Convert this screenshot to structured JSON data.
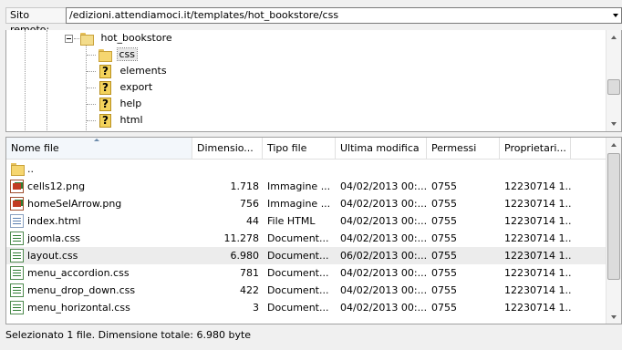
{
  "remote_bar": {
    "label": "Sito remoto:",
    "path": "/edizioni.attendiamoci.it/templates/hot_bookstore/css"
  },
  "tree": {
    "parent": {
      "label": "hot_bookstore",
      "icon": "open-folder-icon"
    },
    "children": [
      {
        "label": "css",
        "icon": "folder-icon",
        "selected": true
      },
      {
        "label": "elements",
        "icon": "unknown-folder-icon"
      },
      {
        "label": "export",
        "icon": "unknown-folder-icon"
      },
      {
        "label": "help",
        "icon": "unknown-folder-icon"
      },
      {
        "label": "html",
        "icon": "unknown-folder-icon"
      }
    ]
  },
  "file_list": {
    "columns": [
      "Nome file",
      "Dimensio...",
      "Tipo file",
      "Ultima modifica",
      "Permessi",
      "Proprietari..."
    ],
    "rows": [
      {
        "icon": "folder",
        "name": "..",
        "size": "",
        "type": "",
        "modified": "",
        "perms": "",
        "owner": ""
      },
      {
        "icon": "img",
        "name": "cells12.png",
        "size": "1.718",
        "type": "Immagine ...",
        "modified": "04/02/2013 00:...",
        "perms": "0755",
        "owner": "12230714 1..."
      },
      {
        "icon": "img",
        "name": "homeSelArrow.png",
        "size": "756",
        "type": "Immagine ...",
        "modified": "04/02/2013 00:...",
        "perms": "0755",
        "owner": "12230714 1..."
      },
      {
        "icon": "html",
        "name": "index.html",
        "size": "44",
        "type": "File HTML",
        "modified": "04/02/2013 00:...",
        "perms": "0755",
        "owner": "12230714 1..."
      },
      {
        "icon": "css",
        "name": "joomla.css",
        "size": "11.278",
        "type": "Document...",
        "modified": "04/02/2013 00:...",
        "perms": "0755",
        "owner": "12230714 1..."
      },
      {
        "icon": "css",
        "name": "layout.css",
        "size": "6.980",
        "type": "Document...",
        "modified": "06/02/2013 00:...",
        "perms": "0755",
        "owner": "12230714 1...",
        "selected": true
      },
      {
        "icon": "css",
        "name": "menu_accordion.css",
        "size": "781",
        "type": "Document...",
        "modified": "04/02/2013 00:...",
        "perms": "0755",
        "owner": "12230714 1..."
      },
      {
        "icon": "css",
        "name": "menu_drop_down.css",
        "size": "422",
        "type": "Document...",
        "modified": "04/02/2013 00:...",
        "perms": "0755",
        "owner": "12230714 1..."
      },
      {
        "icon": "css",
        "name": "menu_horizontal.css",
        "size": "3",
        "type": "Document...",
        "modified": "04/02/2013 00:...",
        "perms": "0755",
        "owner": "12230714 1..."
      }
    ]
  },
  "status": {
    "text": "Selezionato 1 file. Dimensione totale: 6.980 byte"
  }
}
